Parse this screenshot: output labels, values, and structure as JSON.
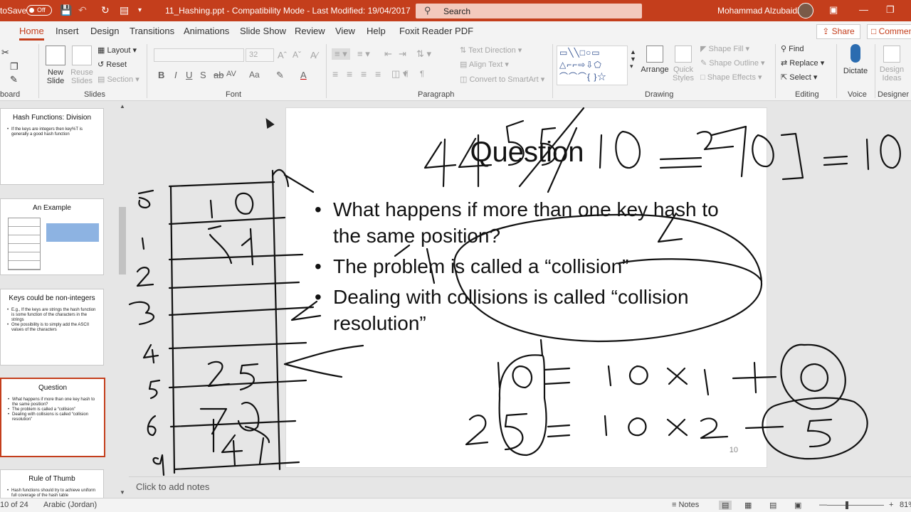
{
  "titlebar": {
    "autosave_label": "toSave",
    "autosave_state": "Off",
    "document": "11_Hashing.ppt  -  Compatibility Mode  -  Last Modified: 19/04/2017",
    "search_placeholder": "Search",
    "user": "Mohammad Alzubaidi",
    "accent": "#c43e1c"
  },
  "tabs": [
    "Home",
    "Insert",
    "Design",
    "Transitions",
    "Animations",
    "Slide Show",
    "Review",
    "View",
    "Help",
    "Foxit Reader PDF"
  ],
  "active_tab": "Home",
  "share_label": "Share",
  "comments_label": "Commen",
  "ribbon": {
    "clipboard": {
      "label": "board"
    },
    "slides": {
      "label": "Slides",
      "new_slide": "New Slide",
      "reuse_slides": "Reuse Slides",
      "layout": "Layout",
      "reset": "Reset",
      "section": "Section"
    },
    "font": {
      "label": "Font",
      "size": "32"
    },
    "paragraph": {
      "label": "Paragraph",
      "text_direction": "Text Direction",
      "align_text": "Align Text",
      "convert_smartart": "Convert to SmartArt"
    },
    "drawing": {
      "label": "Drawing",
      "arrange": "Arrange",
      "quick_styles": "Quick Styles",
      "shape_fill": "Shape Fill",
      "shape_outline": "Shape Outline",
      "shape_effects": "Shape Effects"
    },
    "editing": {
      "label": "Editing",
      "find": "Find",
      "replace": "Replace",
      "select": "Select"
    },
    "voice": {
      "label": "Voice",
      "dictate": "Dictate"
    },
    "designer": {
      "label": "Designer",
      "design_ideas": "Design Ideas"
    }
  },
  "thumbnails": [
    {
      "title": "Hash Functions: Division",
      "bullets": [
        "If the keys are integers then key%T  is generally a good hash function"
      ]
    },
    {
      "title": "An Example",
      "bullets": []
    },
    {
      "title": "Keys could be non-integers",
      "bullets": [
        "E.g., If the keys are strings the hash function is some function of the characters in the strings",
        "One possibility is to simply add the ASCII values of the characters"
      ]
    },
    {
      "title": "Question",
      "bullets": [
        "What happens if more than one key hash to the same position?",
        "The problem is called a “collision”",
        "Dealing with collisions is called “collision resolution”"
      ]
    },
    {
      "title": "Rule of Thumb",
      "bullets": [
        "Hash functions should try to achieve uniform full coverage of the hash table"
      ]
    }
  ],
  "slide": {
    "title": "Question",
    "bullets": [
      "What happens if more than one key hash to the same position?",
      "The problem is called a “collision”",
      "Dealing with collisions is called “collision resolution”"
    ],
    "page_number": "10"
  },
  "notes_placeholder": "Click to add notes",
  "status": {
    "slide_count": "10 of 24",
    "language": "Arabic (Jordan)",
    "notes": "Notes",
    "zoom": "81%"
  }
}
